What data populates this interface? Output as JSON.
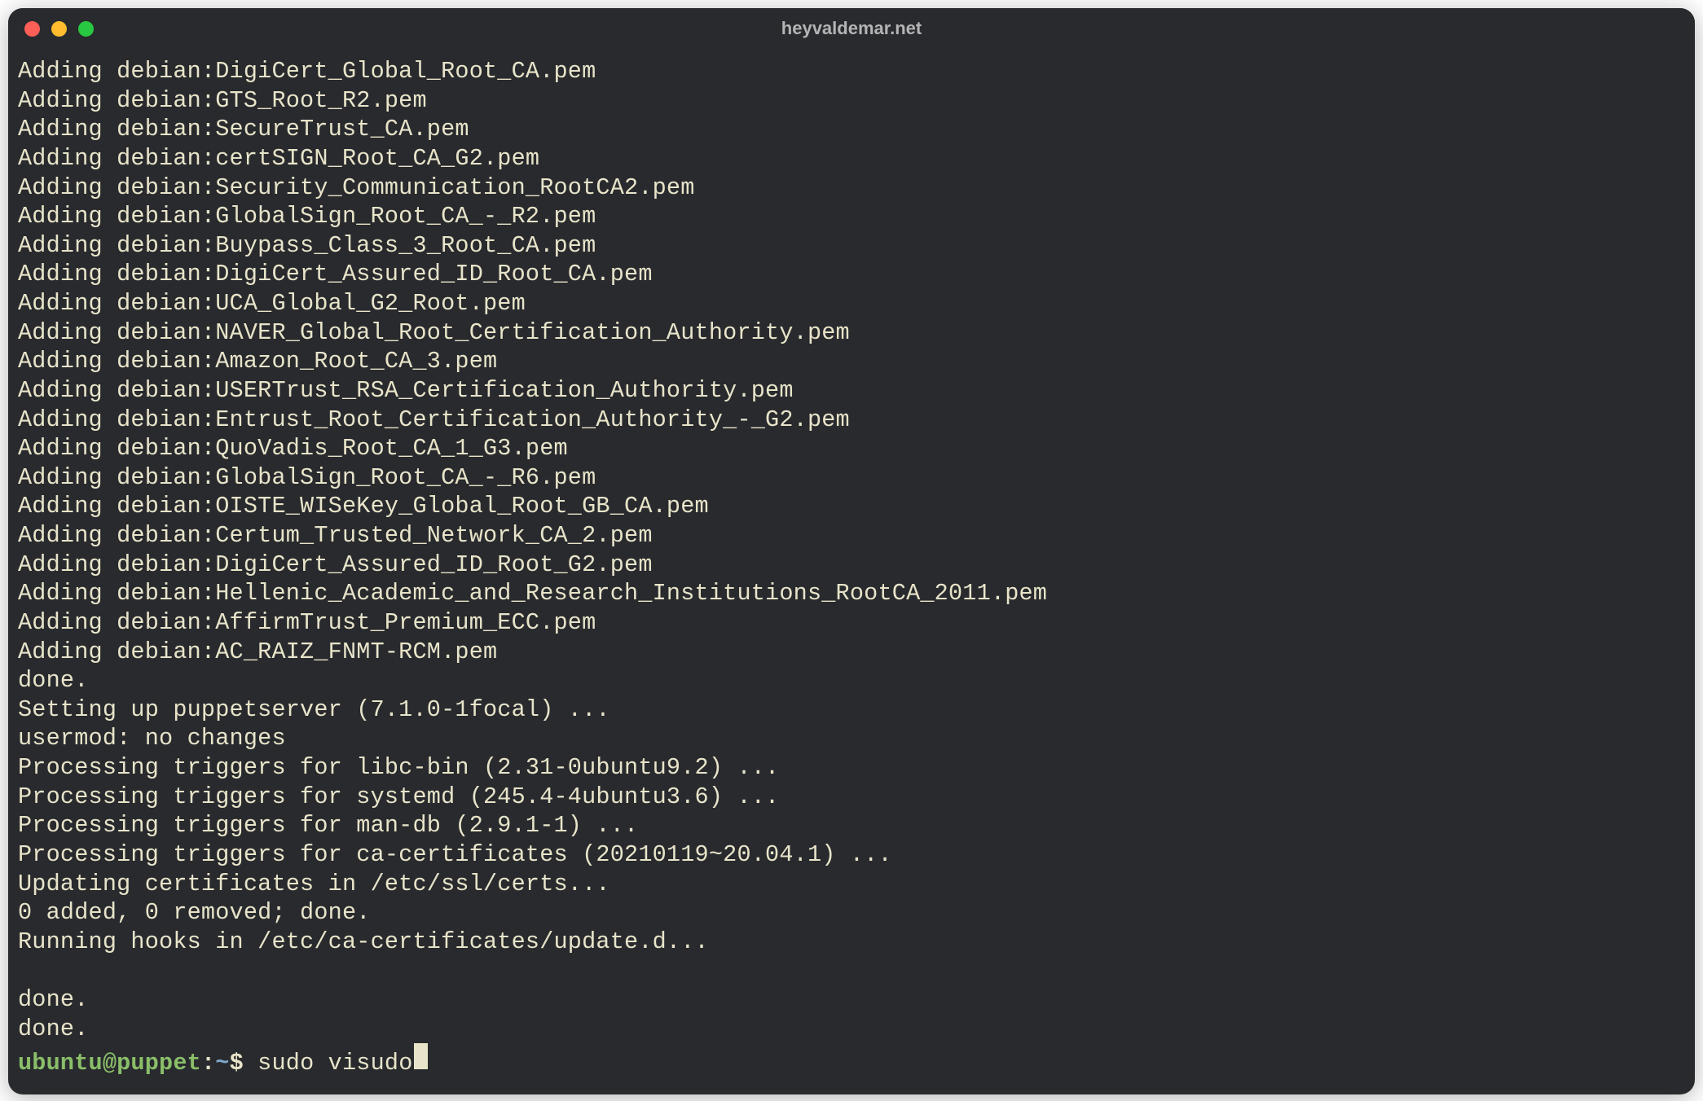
{
  "window": {
    "title": "heyvaldemar.net"
  },
  "output_lines": [
    "Adding debian:DigiCert_Global_Root_CA.pem",
    "Adding debian:GTS_Root_R2.pem",
    "Adding debian:SecureTrust_CA.pem",
    "Adding debian:certSIGN_Root_CA_G2.pem",
    "Adding debian:Security_Communication_RootCA2.pem",
    "Adding debian:GlobalSign_Root_CA_-_R2.pem",
    "Adding debian:Buypass_Class_3_Root_CA.pem",
    "Adding debian:DigiCert_Assured_ID_Root_CA.pem",
    "Adding debian:UCA_Global_G2_Root.pem",
    "Adding debian:NAVER_Global_Root_Certification_Authority.pem",
    "Adding debian:Amazon_Root_CA_3.pem",
    "Adding debian:USERTrust_RSA_Certification_Authority.pem",
    "Adding debian:Entrust_Root_Certification_Authority_-_G2.pem",
    "Adding debian:QuoVadis_Root_CA_1_G3.pem",
    "Adding debian:GlobalSign_Root_CA_-_R6.pem",
    "Adding debian:OISTE_WISeKey_Global_Root_GB_CA.pem",
    "Adding debian:Certum_Trusted_Network_CA_2.pem",
    "Adding debian:DigiCert_Assured_ID_Root_G2.pem",
    "Adding debian:Hellenic_Academic_and_Research_Institutions_RootCA_2011.pem",
    "Adding debian:AffirmTrust_Premium_ECC.pem",
    "Adding debian:AC_RAIZ_FNMT-RCM.pem",
    "done.",
    "Setting up puppetserver (7.1.0-1focal) ...",
    "usermod: no changes",
    "Processing triggers for libc-bin (2.31-0ubuntu9.2) ...",
    "Processing triggers for systemd (245.4-4ubuntu3.6) ...",
    "Processing triggers for man-db (2.9.1-1) ...",
    "Processing triggers for ca-certificates (20210119~20.04.1) ...",
    "Updating certificates in /etc/ssl/certs...",
    "0 added, 0 removed; done.",
    "Running hooks in /etc/ca-certificates/update.d...",
    "",
    "done.",
    "done."
  ],
  "prompt": {
    "user_host": "ubuntu@puppet",
    "colon": ":",
    "path": "~",
    "symbol": "$ ",
    "command": "sudo visudo"
  },
  "colors": {
    "background": "#282a2e",
    "text": "#e8e4c9",
    "prompt_user": "#8abe68",
    "prompt_path": "#7fa6c9"
  }
}
